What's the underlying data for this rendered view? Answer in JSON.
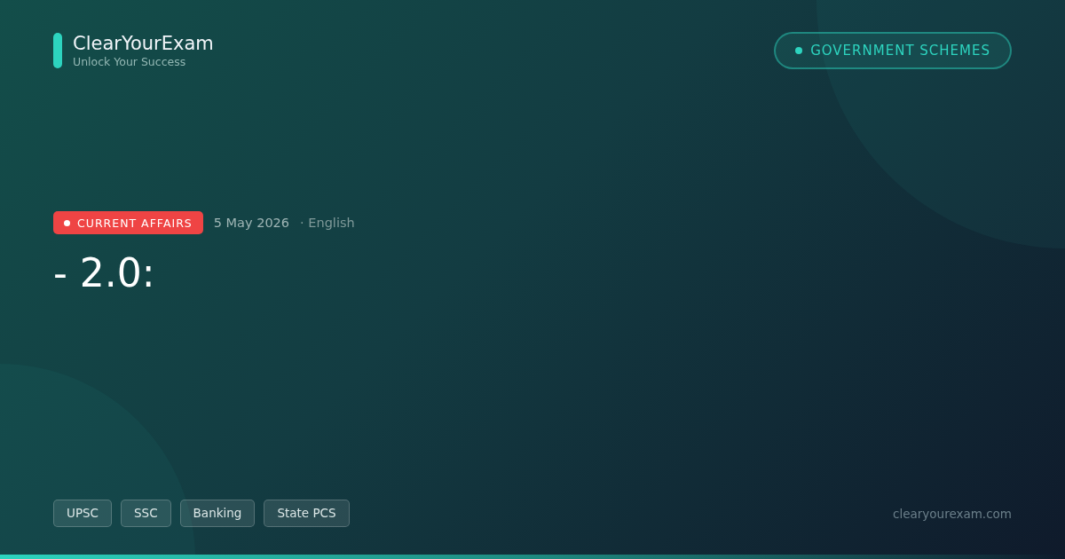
{
  "brand": {
    "name": "ClearYourExam",
    "tagline": "Unlock Your Success"
  },
  "category": {
    "label": "GOVERNMENT SCHEMES"
  },
  "badge": {
    "label": "CURRENT AFFAIRS",
    "color": "#ef4444"
  },
  "date": "5 May 2026",
  "language": "· English",
  "title": "- 2.0:",
  "tags": [
    "UPSC",
    "SSC",
    "Banking",
    "State PCS"
  ],
  "site": "clearyourexam.com"
}
